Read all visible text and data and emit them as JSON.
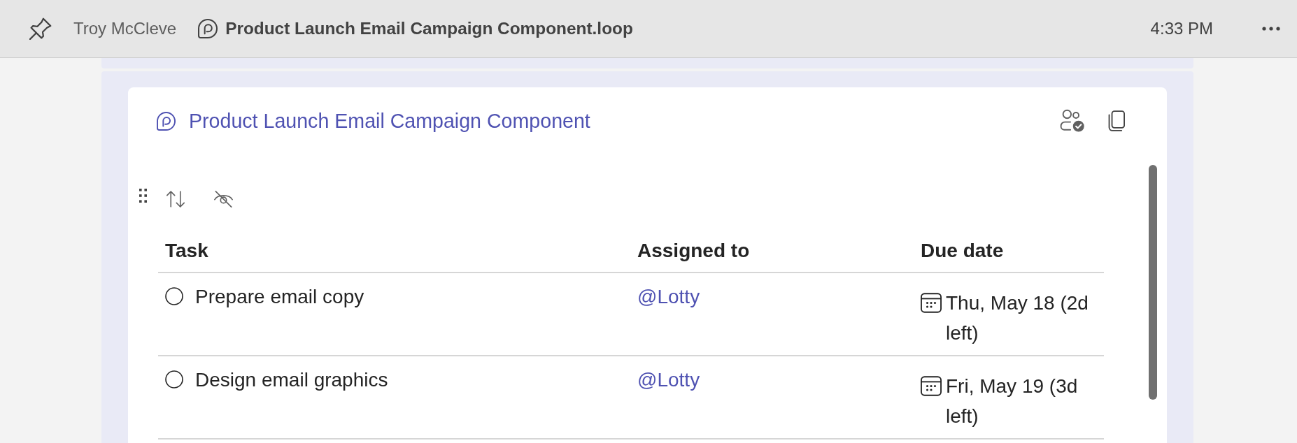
{
  "title_bar": {
    "author": "Troy McCleve",
    "file_name": "Product Launch Email Campaign Component.loop",
    "time": "4:33 PM"
  },
  "component": {
    "title": "Product Launch Email Campaign Component"
  },
  "table": {
    "columns": [
      "Task",
      "Assigned to",
      "Due date"
    ],
    "rows": [
      {
        "task": "Prepare email copy",
        "completed": false,
        "assigned_to": "@Lotty",
        "due_date": "Thu, May 18 (2d left)"
      },
      {
        "task": "Design email graphics",
        "completed": false,
        "assigned_to": "@Lotty",
        "due_date": "Fri, May 19 (3d left)"
      }
    ]
  }
}
